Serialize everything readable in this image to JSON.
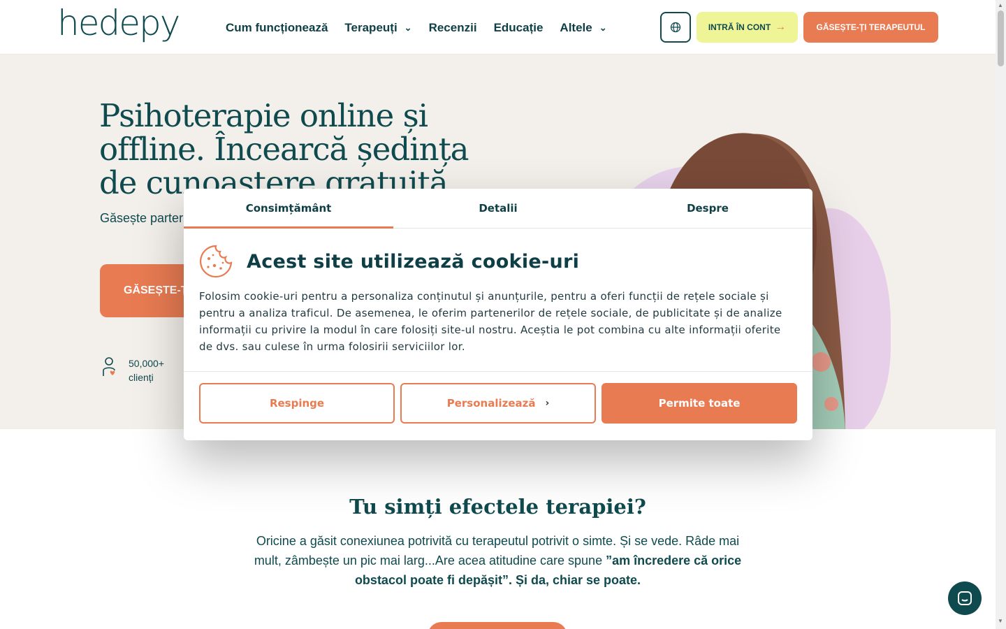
{
  "header": {
    "logo": "hedepy",
    "nav": [
      {
        "label": "Cum funcționează"
      },
      {
        "label": "Terapeuți"
      },
      {
        "label": "Recenzii"
      },
      {
        "label": "Educație"
      },
      {
        "label": "Altele"
      }
    ],
    "login_label": "INTRĂ ÎN CONT",
    "find_label": "GĂSEȘTE-ȚI TERAPEUTUL"
  },
  "hero": {
    "title": "Psihoterapie online și offline. Încearcă ședința de cunoaștere gratuită",
    "subtitle": "Găsește parter… comunitatea n…",
    "cta": "GĂSEȘTE-ȚI",
    "stat_value": "50,000+",
    "stat_label": "clienți"
  },
  "section": {
    "title": "Tu simți efectele terapiei?",
    "text_start": "Oricine a găsit conexiunea potrivită cu terapeutul potrivit o simte. Și se vede. Râde mai mult, zâmbește un pic mai larg...Are acea atitudine care spune ",
    "text_bold": "”am încredere că orice obstacol poate fi depășit”. Și da, chiar se poate."
  },
  "cookie": {
    "tabs": [
      "Consimțământ",
      "Detalii",
      "Despre"
    ],
    "title": "Acest site utilizează cookie-uri",
    "body": "Folosim cookie-uri pentru a personaliza conținutul și anunțurile, pentru a oferi funcții de rețele sociale și pentru a analiza traficul. De asemenea, le oferim partenerilor de rețele sociale, de publicitate și de analize informații cu privire la modul în care folosiți site-ul nostru. Aceștia le pot combina cu alte informații oferite de dvs. sau culese în urma folosirii serviciilor lor.",
    "reject": "Respinge",
    "customize": "Personalizează",
    "allow": "Permite toate"
  },
  "colors": {
    "brand_teal": "#0f4a4f",
    "accent_orange": "#e87b52",
    "login_yellow": "#eff597",
    "hero_bg": "#f3efea"
  }
}
